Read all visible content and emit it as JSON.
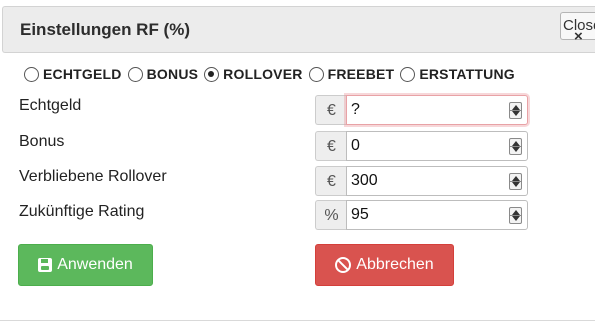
{
  "dialog": {
    "title": "Einstellungen RF (%)",
    "close_label": "Close",
    "close_icon": "×"
  },
  "radio_options": [
    {
      "label": "ECHTGELD",
      "checked": false
    },
    {
      "label": "BONUS",
      "checked": false
    },
    {
      "label": "ROLLOVER",
      "checked": true
    },
    {
      "label": "FREEBET",
      "checked": false
    },
    {
      "label": "ERSTATTUNG",
      "checked": false
    }
  ],
  "fields": [
    {
      "label": "Echtgeld",
      "addon": "€",
      "value": "?",
      "focused": true
    },
    {
      "label": "Bonus",
      "addon": "€",
      "value": "0",
      "focused": false
    },
    {
      "label": "Verbliebene Rollover",
      "addon": "€",
      "value": "300",
      "focused": false
    },
    {
      "label": "Zukünftige Rating",
      "addon": "%",
      "value": "95",
      "focused": false
    }
  ],
  "buttons": {
    "apply_label": "Anwenden",
    "cancel_label": "Abbrechen"
  },
  "colors": {
    "apply": "#5cb85c",
    "cancel": "#d9534f",
    "header_bg": "#ececec",
    "focus_border": "#e8a2a6"
  }
}
